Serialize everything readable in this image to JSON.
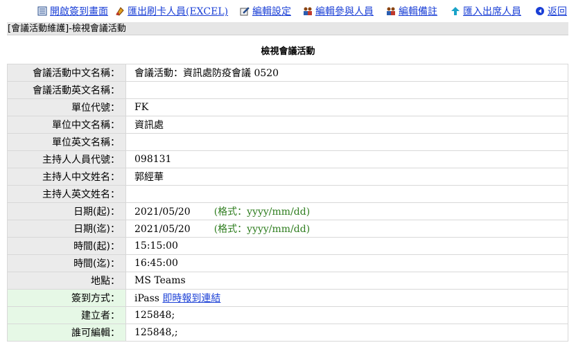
{
  "toolbar": {
    "open_signin": "開啟簽到畫面",
    "export_excel": "匯出刷卡人員(EXCEL)",
    "edit_settings": "編輯設定",
    "edit_participants": "編輯參與人員",
    "edit_notes": "編輯備註",
    "import_attendees": "匯入出席人員",
    "back": "返回"
  },
  "breadcrumb": "[會議活動維護]-檢視會議活動",
  "page_title": "檢視會議活動",
  "fields": {
    "name_zh": {
      "label": "會議活動中文名稱：",
      "value": "會議活動：資訊處防疫會議 0520"
    },
    "name_en": {
      "label": "會議活動英文名稱：",
      "value": ""
    },
    "unit_code": {
      "label": "單位代號：",
      "value": "FK"
    },
    "unit_zh": {
      "label": "單位中文名稱：",
      "value": "資訊處"
    },
    "unit_en": {
      "label": "單位英文名稱：",
      "value": ""
    },
    "host_id": {
      "label": "主持人人員代號：",
      "value": "098131"
    },
    "host_zh": {
      "label": "主持人中文姓名：",
      "value": "郭經華"
    },
    "host_en": {
      "label": "主持人英文姓名：",
      "value": ""
    },
    "date_start": {
      "label": "日期(起)：",
      "value": "2021/05/20",
      "format": "(格式：yyyy/mm/dd)"
    },
    "date_end": {
      "label": "日期(迄)：",
      "value": "2021/05/20",
      "format": "(格式：yyyy/mm/dd)"
    },
    "time_start": {
      "label": "時間(起)：",
      "value": "15:15:00"
    },
    "time_end": {
      "label": "時間(迄)：",
      "value": "16:45:00"
    },
    "location": {
      "label": "地點：",
      "value": "MS Teams"
    },
    "signin_method": {
      "label": "簽到方式：",
      "value": "iPass",
      "link": "即時報到連結"
    },
    "creator": {
      "label": "建立者：",
      "value": "125848;"
    },
    "editors": {
      "label": "誰可編輯：",
      "value": "125848,;"
    }
  },
  "colors": {
    "link": "#1a3fd6",
    "format_hint": "#2e7d1e",
    "label_bg": "#ebebeb",
    "label_bg_green": "#e6f8e6"
  }
}
